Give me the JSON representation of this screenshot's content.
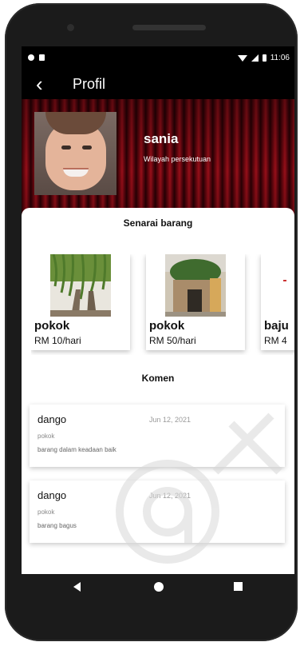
{
  "status_bar": {
    "time": "11:06"
  },
  "app_bar": {
    "title": "Profil",
    "back_icon": "arrow-left-icon"
  },
  "profile": {
    "name": "sania",
    "region": "Wilayah persekutuan"
  },
  "items_section": {
    "title": "Senarai barang",
    "items": [
      {
        "name": "pokok",
        "price": "RM 10/hari"
      },
      {
        "name": "pokok",
        "price": "RM 50/hari"
      },
      {
        "name": "baju",
        "price": "RM 4"
      }
    ]
  },
  "comments_section": {
    "title": "Komen",
    "comments": [
      {
        "user": "dango",
        "date": "Jun 12, 2021",
        "item": "pokok",
        "text": "barang dalam keadaan baik"
      },
      {
        "user": "dango",
        "date": "Jun 12, 2021",
        "item": "pokok",
        "text": "barang bagus"
      }
    ]
  },
  "nav_bar": {
    "back": "nav-back-icon",
    "home": "nav-home-icon",
    "recent": "nav-recent-icon"
  },
  "colors": {
    "banner": "#8a0a14",
    "phone_body": "#1b1b1b"
  }
}
